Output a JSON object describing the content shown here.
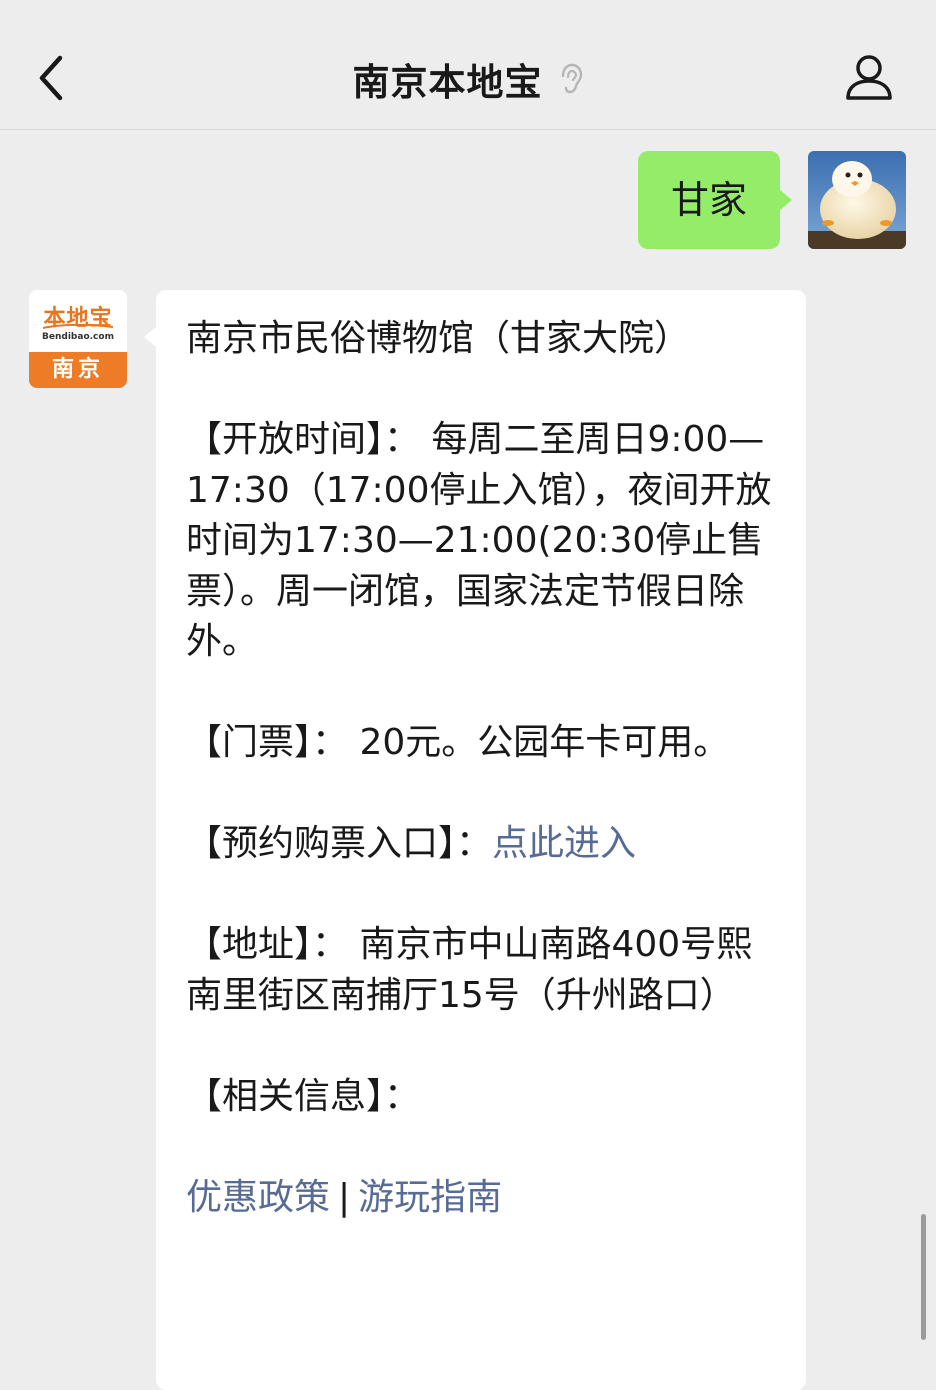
{
  "header": {
    "title": "南京本地宝"
  },
  "outgoing": {
    "text": "甘家"
  },
  "bot": {
    "logo_cn": "本地宝",
    "logo_en": "Bendibao.com",
    "logo_city": "南京"
  },
  "message": {
    "title": "南京市民俗博物馆（甘家大院）",
    "hours": "【开放时间】：  每周二至周日9:00—17:30（17:00停止入馆），夜间开放时间为17:30—21:00(20:30停止售票）。周一闭馆，国家法定节假日除外。",
    "tickets": "【门票】：  20元。公园年卡可用。",
    "booking_label": "【预约购票入口】：",
    "booking_link": "点此进入",
    "address": "【地址】：  南京市中山南路400号熙南里街区南捕厅15号（升州路口）",
    "related_label": "【相关信息】：",
    "link_1": "优惠政策",
    "separator": "|",
    "link_2": "游玩指南"
  },
  "colors": {
    "background": "#ededed",
    "outgoing_bubble": "#95ec69",
    "incoming_bubble": "#ffffff",
    "link": "#576b95",
    "brand_orange": "#ee7b25"
  },
  "icons": [
    "back-arrow-icon",
    "ear-icon",
    "profile-icon"
  ]
}
